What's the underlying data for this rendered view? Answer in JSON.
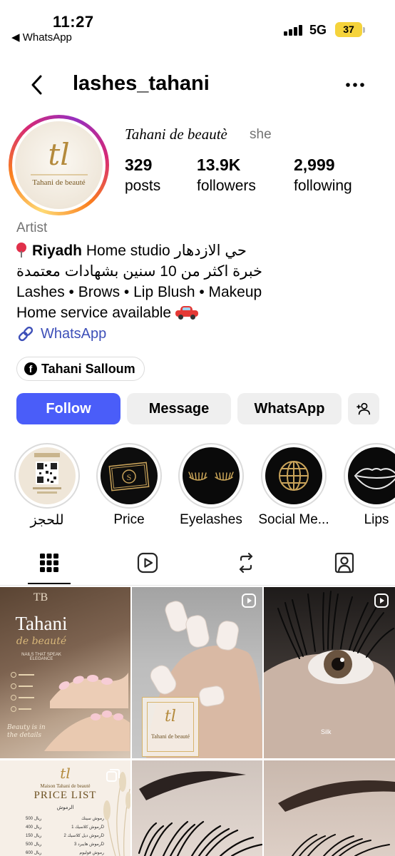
{
  "status_bar": {
    "time": "11:27",
    "back_app": "◀ WhatsApp",
    "network": "5G",
    "battery": "37"
  },
  "header": {
    "username": "lashes_tahani",
    "back_icon": "chevron-left-icon",
    "more_icon": "more-horizontal-icon"
  },
  "profile": {
    "display_name": "Tahani de beautè",
    "pronouns": "she",
    "avatar_monogram": "tl",
    "avatar_text": "Tahani de beauté",
    "stats": [
      {
        "value": "329",
        "label": "posts"
      },
      {
        "value": "13.9K",
        "label": "followers"
      },
      {
        "value": "2,999",
        "label": "following"
      }
    ],
    "category": "Artist",
    "bio": {
      "line1_bold": "Riyadh",
      "line1_rest": " Home studio حي الازدهار",
      "line2": "خبرة اكثر من 10 سنين بشهادات معتمدة",
      "line3": "Lashes • Brows • Lip Blush • Makeup",
      "line4": "Home service available"
    },
    "link_label": "WhatsApp",
    "facebook_pill": "Tahani Salloum"
  },
  "actions": {
    "follow": "Follow",
    "message": "Message",
    "whatsapp": "WhatsApp",
    "suggest_icon": "add-person-icon"
  },
  "highlights": [
    {
      "label": "للحجز",
      "icon": "qr-code-icon"
    },
    {
      "label": "Price",
      "icon": "card-icon"
    },
    {
      "label": "Eyelashes",
      "icon": "lashes-icon"
    },
    {
      "label": "Social Me...",
      "icon": "globe-icon"
    },
    {
      "label": "Lips",
      "icon": "lips-icon"
    }
  ],
  "tabs": [
    {
      "name": "grid",
      "icon": "grid-icon",
      "active": true
    },
    {
      "name": "reels",
      "icon": "reels-icon",
      "active": false
    },
    {
      "name": "reposts",
      "icon": "repost-icon",
      "active": false
    },
    {
      "name": "tagged",
      "icon": "tagged-person-icon",
      "active": false
    }
  ],
  "posts": {
    "post1": {
      "monogram": "TB",
      "title_line1": "Tahani",
      "title_line2": "de beauté",
      "subtitle": "NAILS THAT SPEAK ELEGANCE",
      "tagline": "Beauty is in the details"
    },
    "post2": {
      "monogram": "tl",
      "brand": "Tahani de beauté"
    },
    "post3": {
      "caption": "Silk"
    },
    "post4": {
      "monogram": "tl",
      "brand": "Maison Tahani de beauté",
      "heading": "PRICE LIST",
      "section": "الرموش",
      "rows": [
        {
          "price": "500 ريال",
          "item": "رموش سينك"
        },
        {
          "price": "400 ريال",
          "item": "رموش كلاسيك 1D"
        },
        {
          "price": "150 ريال",
          "item": "رموش ديل كلاسيك 2D"
        },
        {
          "price": "500 ريال",
          "item": "رموش هايبرد 3D"
        },
        {
          "price": "600 ريال",
          "item": "رموش فوليوم"
        }
      ]
    }
  },
  "colors": {
    "accent": "#4a5df9",
    "link": "#3d4fb8",
    "gold": "#b48a3c",
    "muted": "#737373"
  }
}
